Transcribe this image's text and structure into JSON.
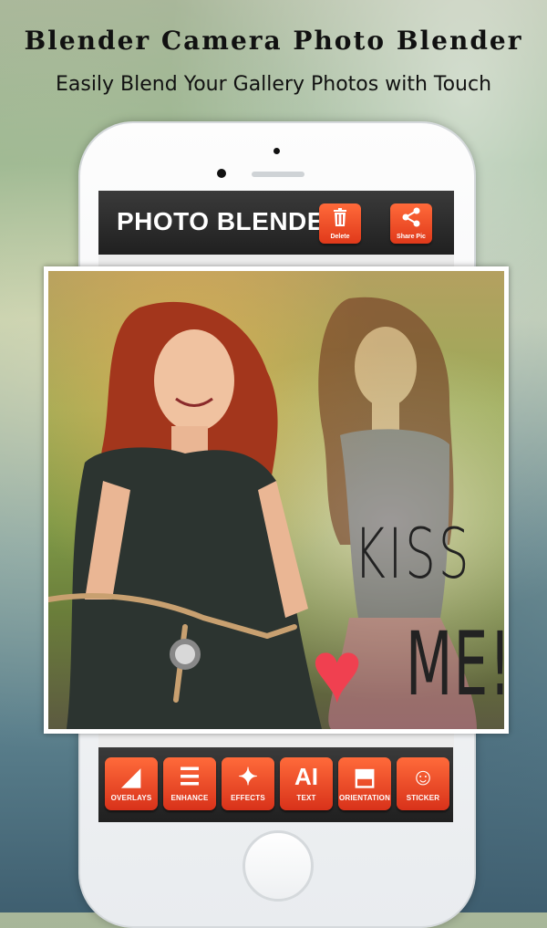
{
  "promo": {
    "title": "Blender Camera Photo Blender",
    "subtitle": "Easily Blend Your Gallery Photos with Touch"
  },
  "app": {
    "title": "PHOTO BLENDER",
    "header_buttons": [
      {
        "label": "Delete",
        "icon": "trash-icon"
      },
      {
        "label": "Share Pic",
        "icon": "share-icon"
      }
    ]
  },
  "photo": {
    "overlay_text_line1": "KISS",
    "overlay_text_line2": "ME!"
  },
  "toolbar": {
    "tools": [
      {
        "label": "OVERLAYS",
        "icon": "overlays-icon",
        "glyph": "◢"
      },
      {
        "label": "ENHANCE",
        "icon": "sliders-icon",
        "glyph": "☰"
      },
      {
        "label": "EFFECTS",
        "icon": "magic-wand-icon",
        "glyph": "✦"
      },
      {
        "label": "TEXT",
        "icon": "text-icon",
        "glyph": "AI"
      },
      {
        "label": "ORIENTATION",
        "icon": "orientation-icon",
        "glyph": "⬒"
      },
      {
        "label": "STICKER",
        "icon": "sticker-icon",
        "glyph": "☺"
      }
    ]
  },
  "colors": {
    "accent": "#e0391a",
    "bar": "#2a2a2a"
  }
}
